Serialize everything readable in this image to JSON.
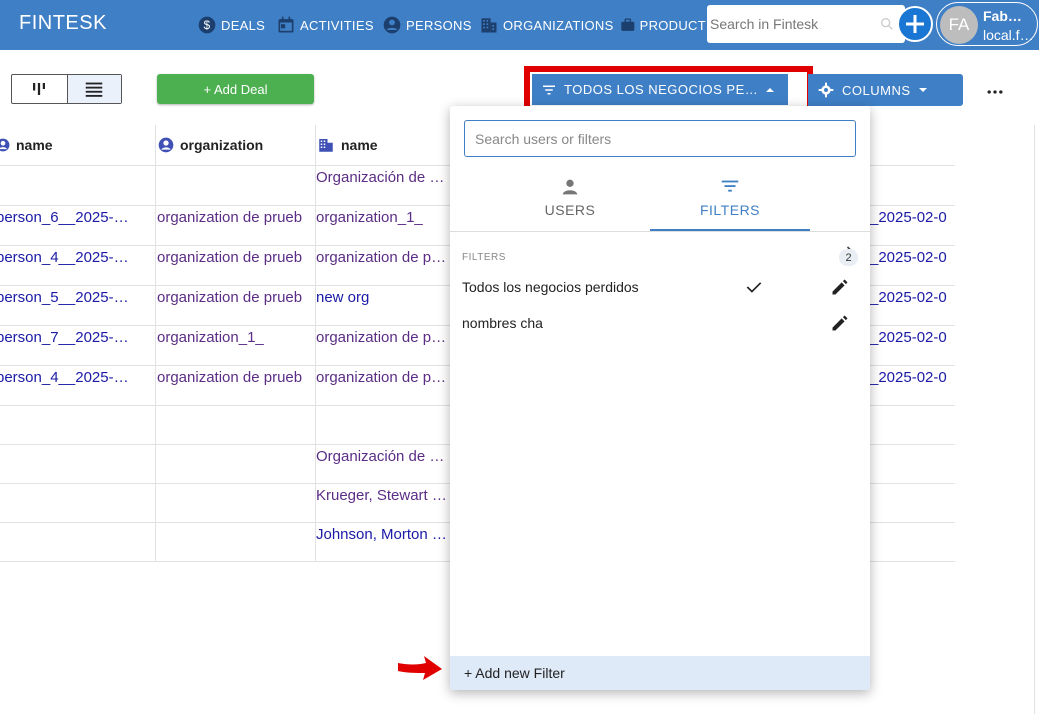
{
  "app": {
    "brand": "FINTESK"
  },
  "nav": [
    {
      "label": "DEALS",
      "icon": "dollar-icon"
    },
    {
      "label": "ACTIVITIES",
      "icon": "calendar-icon"
    },
    {
      "label": "PERSONS",
      "icon": "person-icon"
    },
    {
      "label": "ORGANIZATIONS",
      "icon": "building-icon"
    },
    {
      "label": "PRODUCT",
      "icon": "briefcase-icon"
    }
  ],
  "search": {
    "placeholder": "Search in Fintesk"
  },
  "user": {
    "initials": "FA",
    "name": "Fab…",
    "sub": "local.f…"
  },
  "toolbar": {
    "add_deal_label": "+ Add Deal",
    "filter_label": "TODOS LOS NEGOCIOS PE…",
    "columns_label": "COLUMNS"
  },
  "table": {
    "headers": [
      "name",
      "organization",
      "name"
    ],
    "rows": [
      {
        "person": "",
        "org": "",
        "org_name": "Organización de …",
        "date": ""
      },
      {
        "person": "person_6__2025-…",
        "org": "organization de prueb",
        "org_name": "organization_1_",
        "date": "_2025-02-0"
      },
      {
        "person": "person_4__2025-…",
        "org": "organization de prueb",
        "org_name": "organization de p…",
        "date": "_2025-02-0"
      },
      {
        "person": "person_5__2025-…",
        "org": "organization de prueb",
        "org_name": "new org",
        "date": "_2025-02-0"
      },
      {
        "person": "person_7__2025-…",
        "org": "organization_1_",
        "org_name": "organization de p…",
        "date": "_2025-02-0"
      },
      {
        "person": "person_4__2025-…",
        "org": "organization de prueb",
        "org_name": "organization de p…",
        "date": "_2025-02-0"
      },
      {
        "person": "",
        "org": "",
        "org_name": "",
        "date": ""
      },
      {
        "person": "",
        "org": "",
        "org_name": "Organización de …",
        "date": ""
      },
      {
        "person": "",
        "org": "",
        "org_name": "Krueger, Stewart …",
        "date": ""
      },
      {
        "person": "",
        "org": "",
        "org_name": "Johnson, Morton …",
        "date": ""
      }
    ]
  },
  "dropdown": {
    "search_placeholder": "Search users or filters",
    "tabs": {
      "users": "USERS",
      "filters": "FILTERS"
    },
    "section_label": "FILTERS",
    "section_count": "2",
    "filters": [
      {
        "label": "Todos los negocios perdidos",
        "selected": true
      },
      {
        "label": "nombres cha",
        "selected": false
      }
    ],
    "add_filter_label": "+ Add new Filter"
  },
  "colors": {
    "primary": "#3f7fc6",
    "add_deal": "#4caf50",
    "highlight": "#e00000",
    "link": "#1a1aa6",
    "org_link": "#5b2d86"
  }
}
